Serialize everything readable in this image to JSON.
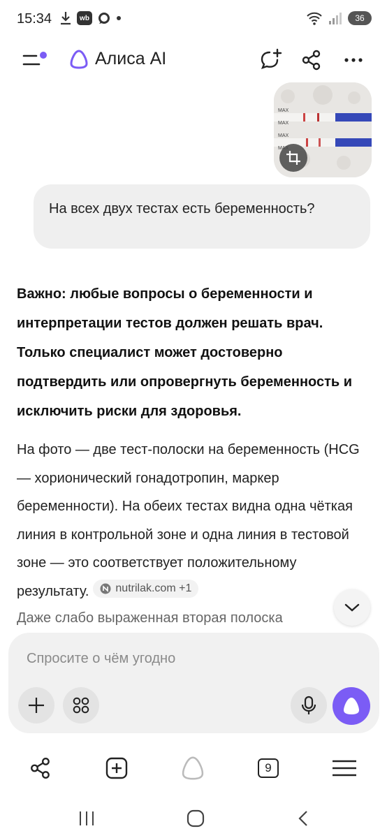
{
  "status_bar": {
    "time": "15:34",
    "left_icons": [
      "download-icon",
      "wb-icon",
      "chat-icon",
      "dot-icon"
    ],
    "wb_label": "wb",
    "battery": "36"
  },
  "header": {
    "app_title": "Алиса AI",
    "icons": [
      "menu-icon",
      "alice-logo-icon",
      "new-chat-icon",
      "share-icon",
      "more-icon"
    ]
  },
  "chat": {
    "user_message": "На всех двух тестах есть беременность?",
    "answer_bold": "Важно: любые вопросы о беременности и интерпретации тестов должен решать врач. Только специалист может достоверно подтвердить или опровергнуть беременность и исключить риски для здоровья.",
    "answer_paragraph": "На фото — две тест-полоски на беременность (HCG — хорионический гонадотропин, маркер беременности). На обеих тестах видна одна чёткая линия в контрольной зоне и одна линия в тестовой зоне — это соответствует положительному результату.",
    "source_chip": "nutrilak.com +1",
    "answer_next": "Даже слабо выраженная вторая полоска",
    "photo_labels": [
      "MAX",
      "MAX",
      "MAX",
      "MAX"
    ]
  },
  "input": {
    "placeholder": "Спросите о чём угодно",
    "icons": [
      "plus-icon",
      "apps-icon",
      "microphone-icon",
      "alice-send-icon"
    ]
  },
  "toolbar": {
    "tabs_count": "9",
    "icons": [
      "share-icon",
      "new-tab-icon",
      "alice-icon",
      "tabs-icon",
      "menu-icon"
    ]
  },
  "system_nav": {
    "icons": [
      "recents-icon",
      "home-icon",
      "back-icon"
    ]
  },
  "colors": {
    "accent": "#7b5cf5",
    "bubble": "#efefef",
    "input_panel": "#f1f1f1"
  }
}
